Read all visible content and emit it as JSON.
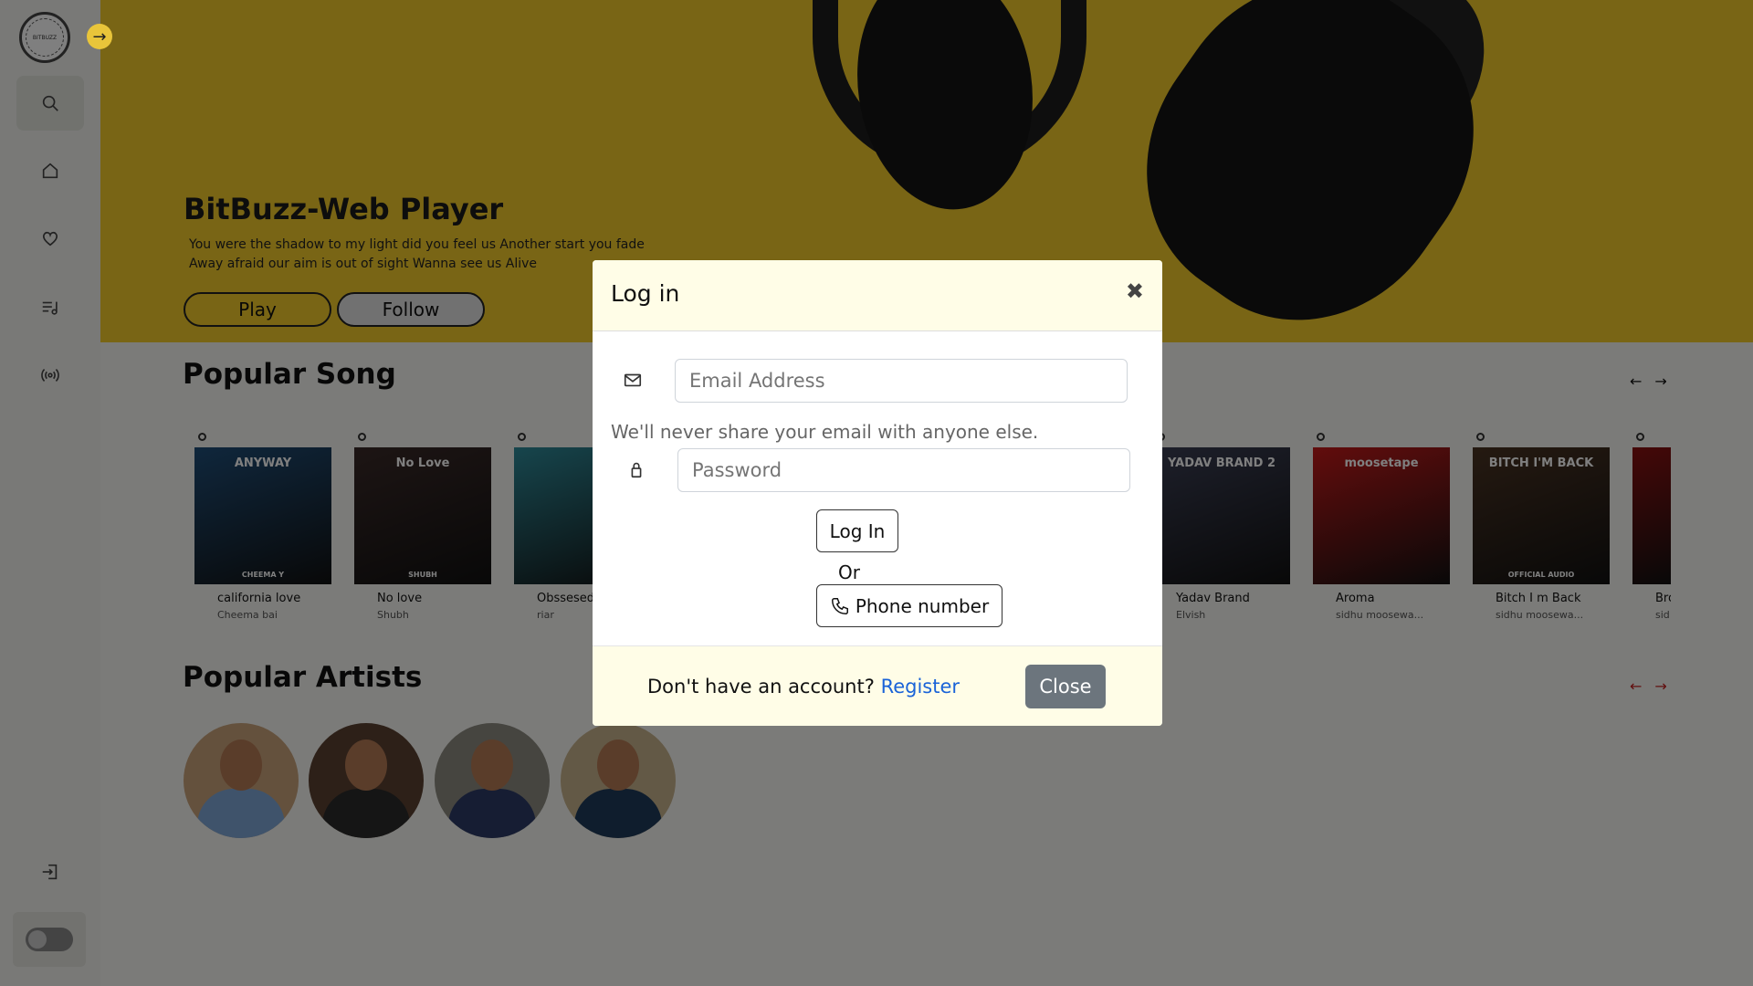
{
  "sidebar": {
    "logo_text": "BITBUZZ",
    "nav": [
      {
        "name": "search",
        "icon": "search-icon"
      },
      {
        "name": "home",
        "icon": "home-icon"
      },
      {
        "name": "favorites",
        "icon": "heart-icon"
      },
      {
        "name": "playlist",
        "icon": "playlist-icon"
      },
      {
        "name": "radio",
        "icon": "broadcast-icon"
      },
      {
        "name": "login",
        "icon": "sign-in-icon"
      }
    ]
  },
  "hero": {
    "title": "BitBuzz-Web Player",
    "subtitle_line1": "You were the shadow to my light did you feel us Another start you fade",
    "subtitle_line2": "Away afraid our aim is out of sight Wanna see us Alive",
    "play_label": "Play",
    "follow_label": "Follow"
  },
  "popular_songs": {
    "title": "Popular Song",
    "items": [
      {
        "name": "california love",
        "artist": "Cheema bai",
        "cover_text": "ANYWAY",
        "cover_sub": "CHEEMA Y",
        "color": "#1f4e79"
      },
      {
        "name": "No love",
        "artist": "Shubh",
        "cover_text": "No Love",
        "cover_sub": "SHUBH",
        "color": "#3a2a28"
      },
      {
        "name": "Obssesed",
        "artist": "riar",
        "cover_text": "",
        "cover_sub": "",
        "color": "#2e8b9a"
      },
      {
        "name": "Yadav Brand",
        "artist": "Elvish",
        "cover_text": "YADAV BRAND 2",
        "cover_sub": "",
        "color": "#3b3f55"
      },
      {
        "name": "Aroma",
        "artist": "sidhu moosewa...",
        "cover_text": "moosetape",
        "cover_sub": "",
        "color": "#c41a1a"
      },
      {
        "name": "Bitch I m Back",
        "artist": "sidhu moosewa...",
        "cover_text": "BITCH I'M BACK",
        "cover_sub": "OFFICIAL AUDIO",
        "color": "#4a3322"
      },
      {
        "name": "Bro",
        "artist": "sid",
        "cover_text": "",
        "cover_sub": "",
        "color": "#8a1010"
      }
    ]
  },
  "popular_artists": {
    "title": "Popular Artists",
    "items": [
      {
        "label": "artist-1",
        "shirt": "#7fa7d6",
        "bg": "#c9a27a"
      },
      {
        "label": "artist-2",
        "shirt": "#2a2a2a",
        "bg": "#5a4030"
      },
      {
        "label": "artist-3",
        "shirt": "#2c3a66",
        "bg": "#8c8a80"
      },
      {
        "label": "artist-4",
        "shirt": "#1e3a5a",
        "bg": "#c7b28c"
      }
    ]
  },
  "modal": {
    "title": "Log in",
    "close_x": "✖",
    "email_placeholder": "Email Address",
    "email_help": "We'll never share your email with anyone else.",
    "password_placeholder": "Password",
    "login_label": "Log In",
    "or_label": "Or",
    "phone_label": "Phone number",
    "footer_text": "Don't have an account?",
    "register_label": "Register",
    "close_label": "Close"
  },
  "colors": {
    "hero_bg": "#f2ca2a",
    "modal_bg": "#fffde7",
    "link": "#1a63d8",
    "close_btn": "#6c757d"
  }
}
